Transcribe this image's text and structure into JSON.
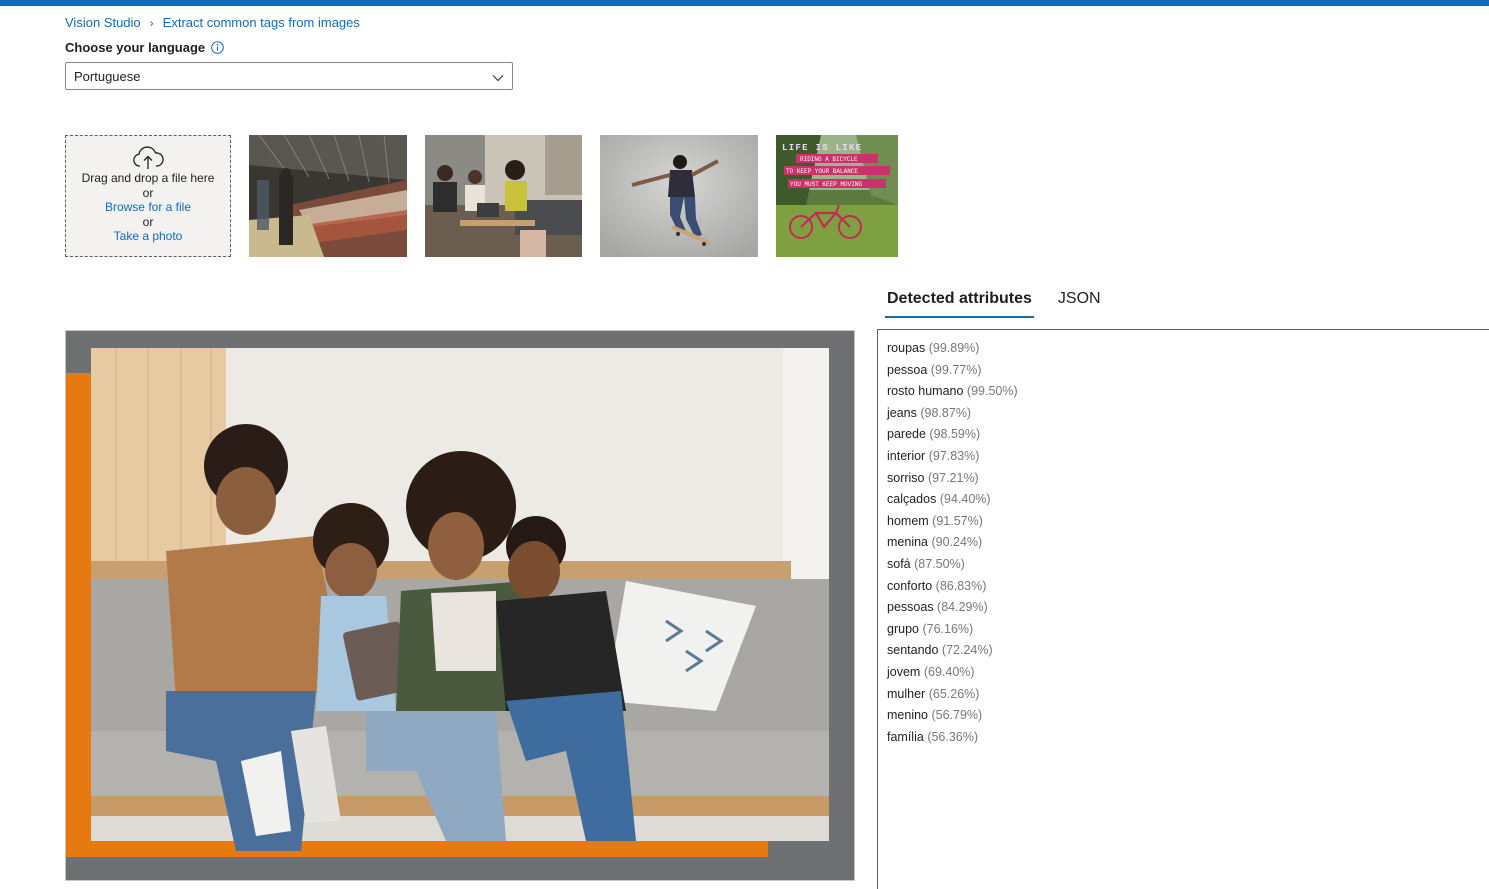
{
  "breadcrumb": {
    "root": "Vision Studio",
    "current": "Extract common tags from images"
  },
  "language": {
    "label": "Choose your language",
    "selected": "Portuguese"
  },
  "upload": {
    "drag_text": "Drag and drop a file here",
    "or_1": "or",
    "browse": "Browse for a file",
    "or_2": "or",
    "photo": "Take a photo"
  },
  "tabs": {
    "detected": "Detected attributes",
    "json": "JSON"
  },
  "thumbnail_text": {
    "line1": "LIFE IS LIKE",
    "line2": "RIDING A BICYCLE",
    "line3": "TO KEEP YOUR BALANCE",
    "line4": "YOU MUST KEEP MOVING"
  },
  "colors": {
    "accent": "#0f6cbd",
    "orange": "#e67a10"
  },
  "attributes": [
    {
      "name": "roupas",
      "score": "(99.89%)"
    },
    {
      "name": "pessoa",
      "score": "(99.77%)"
    },
    {
      "name": "rosto humano",
      "score": "(99.50%)"
    },
    {
      "name": "jeans",
      "score": "(98.87%)"
    },
    {
      "name": "parede",
      "score": "(98.59%)"
    },
    {
      "name": "interior",
      "score": "(97.83%)"
    },
    {
      "name": "sorriso",
      "score": "(97.21%)"
    },
    {
      "name": "calçados",
      "score": "(94.40%)"
    },
    {
      "name": "homem",
      "score": "(91.57%)"
    },
    {
      "name": "menina",
      "score": "(90.24%)"
    },
    {
      "name": "sofá",
      "score": "(87.50%)"
    },
    {
      "name": "conforto",
      "score": "(86.83%)"
    },
    {
      "name": "pessoas",
      "score": "(84.29%)"
    },
    {
      "name": "grupo",
      "score": "(76.16%)"
    },
    {
      "name": "sentando",
      "score": "(72.24%)"
    },
    {
      "name": "jovem",
      "score": "(69.40%)"
    },
    {
      "name": "mulher",
      "score": "(65.26%)"
    },
    {
      "name": "menino",
      "score": "(56.79%)"
    },
    {
      "name": "família",
      "score": "(56.36%)"
    }
  ]
}
